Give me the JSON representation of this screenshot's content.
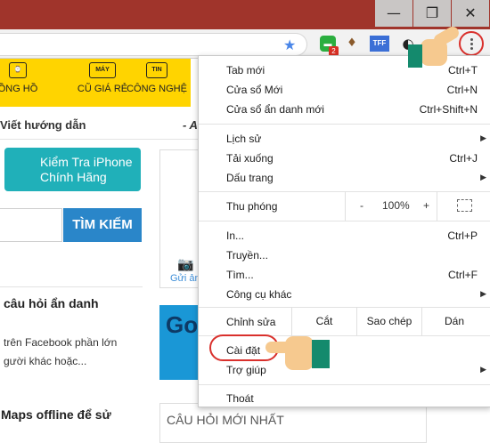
{
  "window": {
    "min": "—",
    "max": "❐",
    "close": "✕"
  },
  "toolbar": {
    "star": "★",
    "ext_badge": "2",
    "ext_tff": "TFF",
    "ext_stamp": "♦",
    "ext_moon": "◐"
  },
  "nav": [
    {
      "icon": "⌚",
      "label": "ỒNG HỒ"
    },
    {
      "icon": "MÁY",
      "label": "CŨ GIÁ RẺ"
    },
    {
      "icon": "TIN",
      "label": "CÔNG NGHỆ"
    }
  ],
  "content": {
    "guide": "Viết hướng dẫn",
    "guide_right": "- A",
    "iphone_line1": "Kiểm Tra iPhone",
    "iphone_line2": "Chính Hãng",
    "search": "TÌM KIẾM",
    "ask_title": "câu hỏi ẩn danh",
    "ask_line1": "trên Facebook phần lớn",
    "ask_line2": "gười khác hoặc...",
    "maps_title": "Maps offline để sử",
    "send": "Gửi ản",
    "banner": "Go",
    "latest": "CÂU HỎI MỚI NHẤT"
  },
  "menu": {
    "new_tab": "Tab mới",
    "new_tab_sc": "Ctrl+T",
    "new_window": "Cửa sổ Mới",
    "new_window_sc": "Ctrl+N",
    "incognito": "Cửa sổ ẩn danh mới",
    "incognito_sc": "Ctrl+Shift+N",
    "history": "Lịch sử",
    "downloads": "Tải xuống",
    "downloads_sc": "Ctrl+J",
    "bookmarks": "Dấu trang",
    "zoom": "Thu phóng",
    "zoom_minus": "-",
    "zoom_value": "100%",
    "zoom_plus": "+",
    "print": "In...",
    "print_sc": "Ctrl+P",
    "cast": "Truyền...",
    "find": "Tìm...",
    "find_sc": "Ctrl+F",
    "more_tools": "Công cụ khác",
    "edit": "Chỉnh sửa",
    "cut": "Cắt",
    "copy": "Sao chép",
    "paste": "Dán",
    "settings": "Cài đặt",
    "help": "Trợ giúp",
    "exit": "Thoát"
  }
}
